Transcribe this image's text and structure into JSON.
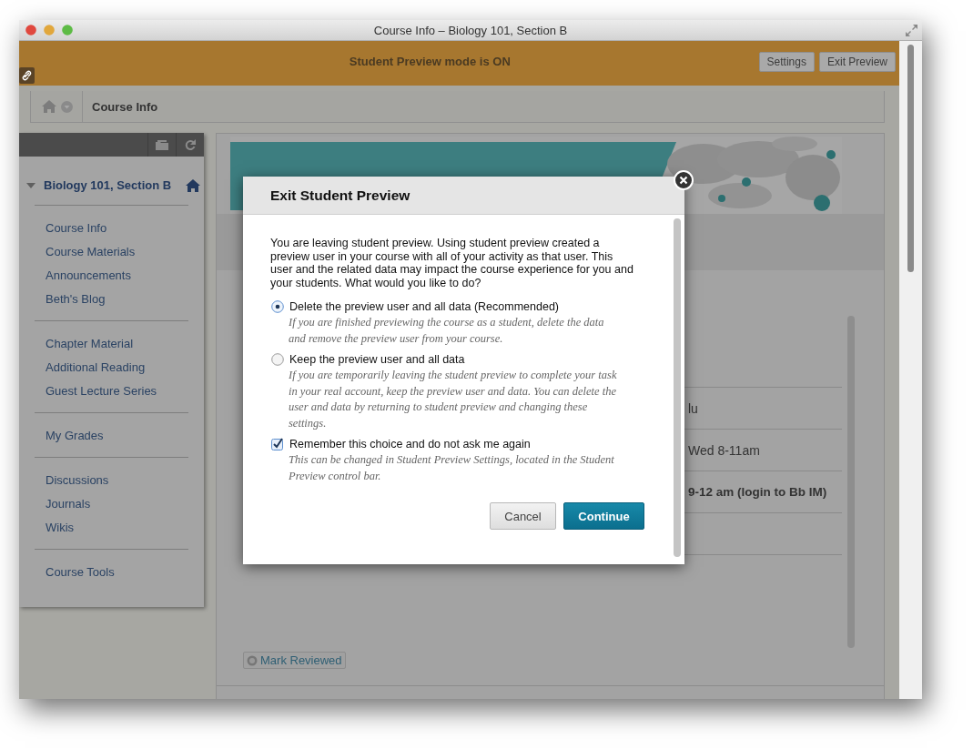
{
  "window": {
    "title": "Course Info – Biology 101, Section B"
  },
  "preview_bar": {
    "message": "Student Preview mode is ON",
    "buttons": [
      "Settings",
      "Exit Preview"
    ]
  },
  "breadcrumb": {
    "current": "Course Info"
  },
  "sidebar": {
    "course_title": "Biology 101, Section B",
    "expanded": true,
    "groups": [
      [
        "Course Info",
        "Course Materials",
        "Announcements",
        "Beth's Blog"
      ],
      [
        "Chapter Material",
        "Additional Reading",
        "Guest Lecture Series"
      ],
      [
        "My Grades"
      ],
      [
        "Discussions",
        "Journals",
        "Wikis"
      ],
      [
        "Course Tools"
      ]
    ]
  },
  "content": {
    "rows": [
      {
        "text": "lu",
        "kind": "plain"
      },
      {
        "text": "Wed 8-11am",
        "kind": "plain"
      },
      {
        "text": "9-12 am (login to Bb IM)",
        "kind": "bold"
      }
    ],
    "mark_reviewed": "Mark Reviewed"
  },
  "dialog": {
    "title": "Exit Student Preview",
    "intro": "You are leaving student preview. Using student preview created a preview user in your course with all of your activity as that user. This user and the related data may impact the course experience for you and your students. What would you like to do?",
    "options": [
      {
        "label": "Delete the preview user and all data (Recommended)",
        "description": "If you are finished previewing the course as a student, delete the data and remove the preview user from your course.",
        "selected": true
      },
      {
        "label": "Keep the preview user and all data",
        "description": "If you are temporarily leaving the student preview to complete your task in your real account, keep the preview user and data. You can delete the user and data by returning to student preview and changing these settings.",
        "selected": false
      }
    ],
    "remember": {
      "label": "Remember this choice and do not ask me again",
      "description": "This can be changed in Student Preview Settings, located in the Student Preview control bar.",
      "checked": true
    },
    "buttons": [
      {
        "label": "Cancel",
        "kind": "secondary"
      },
      {
        "label": "Continue",
        "kind": "primary"
      }
    ]
  }
}
